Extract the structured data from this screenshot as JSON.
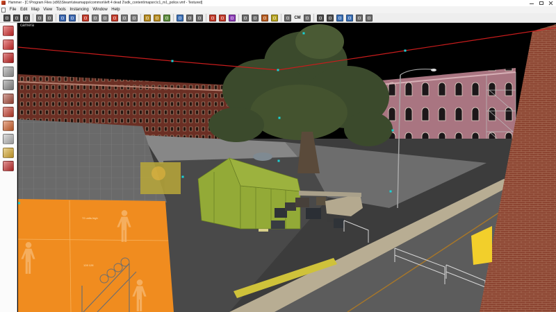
{
  "window": {
    "title": "Hammer - [C:\\Program Files (x86)\\Steam\\steamapps\\common\\left 4 dead 2\\sdk_content\\mapsrc\\c1_m1_police.vmf - Textured]",
    "app_icon": "hammer-app-icon",
    "controls": [
      {
        "icon": "minimize-icon"
      },
      {
        "icon": "maximize-icon"
      },
      {
        "icon": "close-icon"
      }
    ]
  },
  "menu": {
    "system_icon": "document-menu-icon",
    "items": [
      "File",
      "Edit",
      "Map",
      "View",
      "Tools",
      "Instancing",
      "Window",
      "Help"
    ]
  },
  "toolbar": {
    "groups": [
      [
        {
          "icon": "toggle-grid-icon",
          "color": "#4a4a4a"
        },
        {
          "icon": "smaller-grid-icon",
          "color": "#4a4a4a"
        },
        {
          "icon": "larger-grid-icon",
          "color": "#4a4a4a"
        }
      ],
      [
        {
          "icon": "toggle-3d-grid-icon",
          "color": "#6b6b6b"
        },
        {
          "icon": "snap-to-grid-icon",
          "color": "#6b6b6b"
        }
      ],
      [
        {
          "icon": "undo-icon",
          "color": "#3a66b0"
        },
        {
          "icon": "redo-icon",
          "color": "#3a66b0"
        }
      ],
      [
        {
          "icon": "carve-icon",
          "color": "#c23a2a"
        },
        {
          "icon": "group-icon",
          "color": "#7a7a7a"
        },
        {
          "icon": "ungroup-icon",
          "color": "#7a7a7a"
        },
        {
          "icon": "hide-selected-icon",
          "color": "#c23a2a"
        },
        {
          "icon": "hide-unselected-icon",
          "color": "#7a7a7a"
        },
        {
          "icon": "show-all-icon",
          "color": "#7a7a7a"
        }
      ],
      [
        {
          "icon": "texture-lock-icon",
          "color": "#b58a1e"
        },
        {
          "icon": "texture-scale-lock-icon",
          "color": "#b58a1e"
        },
        {
          "icon": "texture-application-mode-icon",
          "color": "#5a8a3a"
        }
      ],
      [
        {
          "icon": "entity-report-icon",
          "color": "#3a6fb5"
        },
        {
          "icon": "check-for-problems-icon",
          "color": "#6b6b6b"
        },
        {
          "icon": "map-properties-icon",
          "color": "#6b6b6b"
        }
      ],
      [
        {
          "icon": "run-map-icon",
          "color": "#c23a2a"
        },
        {
          "icon": "toggle-helpers-icon",
          "color": "#c23a2a"
        },
        {
          "icon": "toggle-models-icon",
          "color": "#8a3ab5"
        }
      ],
      [
        {
          "icon": "3d-wireframe-view-icon",
          "color": "#6b6b6b"
        },
        {
          "icon": "3d-flat-view-icon",
          "color": "#6b6b6b"
        },
        {
          "icon": "3d-textured-view-icon",
          "color": "#b55a1e"
        },
        {
          "icon": "3d-lighting-preview-icon",
          "color": "#b5a21e"
        }
      ],
      [
        {
          "icon": "toggle-cordon-icon",
          "color": "#6b6b6b"
        },
        {
          "icon": "cordon-manager-icon",
          "label": "CM",
          "color": "transparent"
        },
        {
          "icon": "edit-cordon-icon",
          "color": "#6b6b6b"
        }
      ],
      [
        {
          "icon": "auto-visgroups-icon",
          "color": "#4a4a4a"
        },
        {
          "icon": "toggle-visgroups-icon",
          "color": "#4a4a4a"
        },
        {
          "icon": "instance-hide-icon",
          "color": "#3a6fb5"
        },
        {
          "icon": "instance-show-icon",
          "color": "#3a6fb5"
        },
        {
          "icon": "manifest-icon",
          "color": "#6b6b6b"
        },
        {
          "icon": "options-icon",
          "color": "#6b6b6b"
        }
      ]
    ]
  },
  "tools_panel": {
    "icons": [
      {
        "icon": "selection-tool-icon",
        "color": "#d42a2a"
      },
      {
        "icon": "magnify-tool-icon",
        "color": "#d42a2a"
      },
      {
        "icon": "camera-tool-icon",
        "color": "#c41e1e"
      },
      {
        "icon": "entity-tool-icon",
        "color": "#9a9a9a"
      },
      {
        "icon": "block-tool-icon",
        "color": "#8a8a8a"
      },
      {
        "icon": "texture-application-tool-icon",
        "color": "#a84a3a"
      },
      {
        "icon": "apply-current-texture-icon",
        "color": "#c43a2a"
      },
      {
        "icon": "decal-tool-icon",
        "color": "#d2602a"
      },
      {
        "icon": "overlay-tool-icon",
        "color": "#b8b8b8"
      },
      {
        "icon": "clipping-tool-icon",
        "color": "#d8a82a"
      },
      {
        "icon": "vertex-tool-icon",
        "color": "#c42a2a"
      }
    ]
  },
  "viewport": {
    "label": "camera",
    "texture_text": {
      "height_label": "72 units high",
      "size_label": "128 128"
    }
  },
  "colors": {
    "sky": "#000000",
    "orange_texture": "#f08c1f",
    "entity_marker": "#19d3d6",
    "selection_line": "#c81c1c",
    "tent": "#a8c632",
    "title_bar": "#ffffff",
    "menu_bar": "#f3f3f3",
    "toolbar": "#eeeeee"
  }
}
